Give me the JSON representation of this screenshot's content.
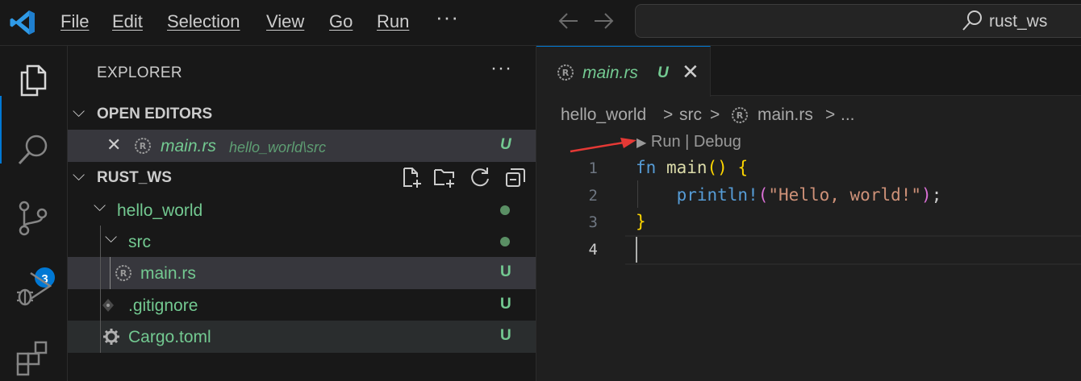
{
  "colors": {
    "accent": "#0078d4",
    "git_untracked": "#73c991",
    "keyword": "#569cd6",
    "function": "#dcdcaa",
    "string": "#ce9178",
    "bracket_level1": "#ffd700",
    "bracket_level2": "#da70d6",
    "annotation_arrow": "#e53935"
  },
  "titlebar": {
    "menu": [
      "File",
      "Edit",
      "Selection",
      "View",
      "Go",
      "Run"
    ],
    "more": "···",
    "back_icon": "arrow-left-icon",
    "forward_icon": "arrow-right-icon",
    "search_text": "rust_ws"
  },
  "activitybar": {
    "items": [
      "explorer-icon",
      "search-icon",
      "source-control-icon",
      "run-debug-icon",
      "extensions-icon"
    ],
    "scm_badge": "3"
  },
  "explorer": {
    "title": "EXPLORER",
    "more": "···",
    "open_editors": {
      "header": "OPEN EDITORS",
      "items": [
        {
          "name": "main.rs",
          "path": "hello_world\\src",
          "status": "U"
        }
      ]
    },
    "workspace": {
      "header": "RUST_WS",
      "tools": [
        "new-file-icon",
        "new-folder-icon",
        "refresh-icon",
        "collapse-all-icon"
      ],
      "tree": [
        {
          "name": "hello_world",
          "status": "dot"
        },
        {
          "name": "src",
          "status": "dot"
        },
        {
          "name": "main.rs",
          "status": "U"
        },
        {
          "name": ".gitignore",
          "status": "U"
        },
        {
          "name": "Cargo.toml",
          "status": "U"
        }
      ]
    }
  },
  "editor": {
    "tab": {
      "name": "main.rs",
      "status": "U",
      "close": "✕"
    },
    "breadcrumb": [
      "hello_world",
      "src",
      "main.rs",
      "..."
    ],
    "breadcrumb_sep": ">",
    "codelens": {
      "run": "Run",
      "separator": "|",
      "debug": "Debug"
    },
    "line_numbers": [
      "1",
      "2",
      "3",
      "4"
    ],
    "code": {
      "line1": {
        "kw": "fn",
        "name": "main",
        "parens": "()",
        "brace": "{"
      },
      "line2": {
        "macro": "println!",
        "open": "(",
        "string": "\"Hello, world!\"",
        "close": ")",
        "semi": ";"
      },
      "line3": {
        "brace": "}"
      }
    }
  }
}
